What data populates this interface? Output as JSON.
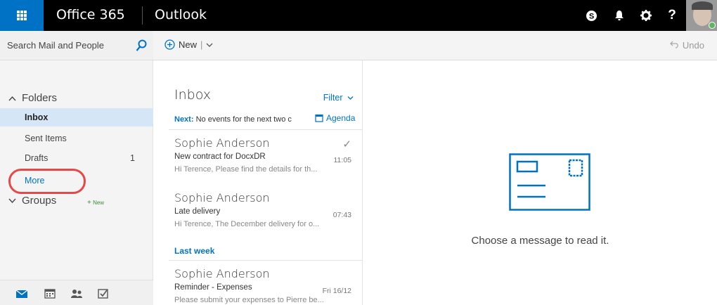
{
  "topbar": {
    "suite_name": "Office 365",
    "app_name": "Outlook",
    "icons": [
      "waffle-icon",
      "skype-icon",
      "bell-icon",
      "gear-icon",
      "help-icon"
    ],
    "help_label": "?"
  },
  "search": {
    "placeholder": "Search Mail and People"
  },
  "commands": {
    "new_label": "New",
    "undo_label": "Undo"
  },
  "nav": {
    "folders_header": "Folders",
    "folders": [
      {
        "label": "Inbox",
        "count": "",
        "selected": true
      },
      {
        "label": "Sent Items",
        "count": ""
      },
      {
        "label": "Drafts",
        "count": "1"
      },
      {
        "label": "More",
        "count": ""
      }
    ],
    "groups_header": "Groups",
    "groups_new": "New",
    "bottom_icons": [
      "mail-icon",
      "calendar-icon",
      "people-icon",
      "tasks-icon"
    ]
  },
  "list": {
    "title": "Inbox",
    "filter_label": "Filter",
    "next_prefix": "Next:",
    "next_text": "No events for the next two c",
    "agenda_label": "Agenda",
    "messages": [
      {
        "from": "Sophie Anderson",
        "subject": "New contract for DocxDR",
        "time": "11:05",
        "preview": "Hi Terence,   Please find the details for th..."
      },
      {
        "from": "Sophie Anderson",
        "subject": "Late delivery",
        "time": "07:43",
        "preview": "Hi Terence,   The December delivery for o..."
      },
      {
        "from": "Sophie Anderson",
        "subject": "Reminder - Expenses",
        "time": "Fri 16/12",
        "preview": "Please submit your expenses to Pierre be..."
      }
    ],
    "last_week_label": "Last week"
  },
  "reading": {
    "empty_message": "Choose a message to read it."
  },
  "colors": {
    "accent": "#0072c6",
    "topbar": "#000000",
    "highlight_ring": "#e44848"
  }
}
